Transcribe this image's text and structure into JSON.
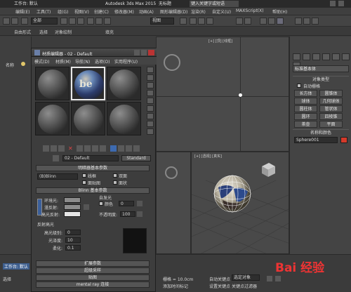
{
  "window": {
    "title_app": "工作台: 默认",
    "title_product": "Autodesk 3ds Max  2015",
    "title_file": "无标题",
    "search_placeholder": "键入关键字或短语"
  },
  "menubar": [
    "编辑(E)",
    "工具(T)",
    "组(G)",
    "视图(V)",
    "创建(C)",
    "修改器(M)",
    "动画(A)",
    "图形编辑器(D)",
    "渲染(R)",
    "自定义(U)",
    "MAXScript(X)",
    "帮助(H)"
  ],
  "toolbar": {
    "selection_set": "全部",
    "view_dropdown": "视图"
  },
  "ribbon": [
    "自由形式",
    "选择",
    "对象绘制",
    "填充"
  ],
  "left_panel": {
    "header": "名称",
    "label1": "工作台: 默认",
    "label2": "选择"
  },
  "viewports": {
    "top": "[+] [顶] [线框]",
    "front": "[+] [前] [线框]",
    "left": "[+] [左] [线框]",
    "persp": "[+] [透视] [真实]"
  },
  "command_panel": {
    "dropdown": "标准基本体",
    "object_type_title": "对象类型",
    "autogrid": "自动栅格",
    "objects": [
      "长方体",
      "圆锥体",
      "球体",
      "几何球体",
      "圆柱体",
      "管状体",
      "圆环",
      "四棱锥",
      "茶壶",
      "平面"
    ],
    "name_color_title": "名称和颜色",
    "object_name": "Sphere001",
    "accent": "#d43a2a"
  },
  "material_editor": {
    "title": "材质编辑器 - 02 - Default",
    "menu": [
      "模式(D)",
      "材质(M)",
      "导航(N)",
      "选项(O)",
      "实用程序(U)"
    ],
    "material_name": "02 - Default",
    "material_type": "Standard",
    "shader_rollout": "明暗器基本参数",
    "shader_type": "(B)Blinn",
    "shader_opts": [
      "线框",
      "双面",
      "面贴图",
      "面状"
    ],
    "blinn_rollout": "Blinn 基本参数",
    "self_illum": "自发光",
    "color_label": "颜色",
    "self_illum_value": "0",
    "opacity_label": "不透明度:",
    "opacity_value": "100",
    "ambient": "环境光:",
    "diffuse": "漫反射:",
    "specular": "高光反射:",
    "specular_group": "反射高光",
    "spec_level": "高光级别:",
    "spec_level_value": "0",
    "glossiness": "光泽度:",
    "glossiness_value": "10",
    "soften": "柔化:",
    "soften_value": "0.1",
    "rollouts": [
      "扩展参数",
      "超级采样",
      "贴图",
      "mental ray 连接"
    ]
  },
  "status": {
    "grid": "栅格 = 10.0cm",
    "autokey": "自动关键点",
    "selected": "选定对象",
    "set_key": "设置关键点",
    "key_filter": "关键点过滤器",
    "add_time_tag": "添加时间标记",
    "left_label": "选择"
  },
  "watermark": "Bai 经验"
}
